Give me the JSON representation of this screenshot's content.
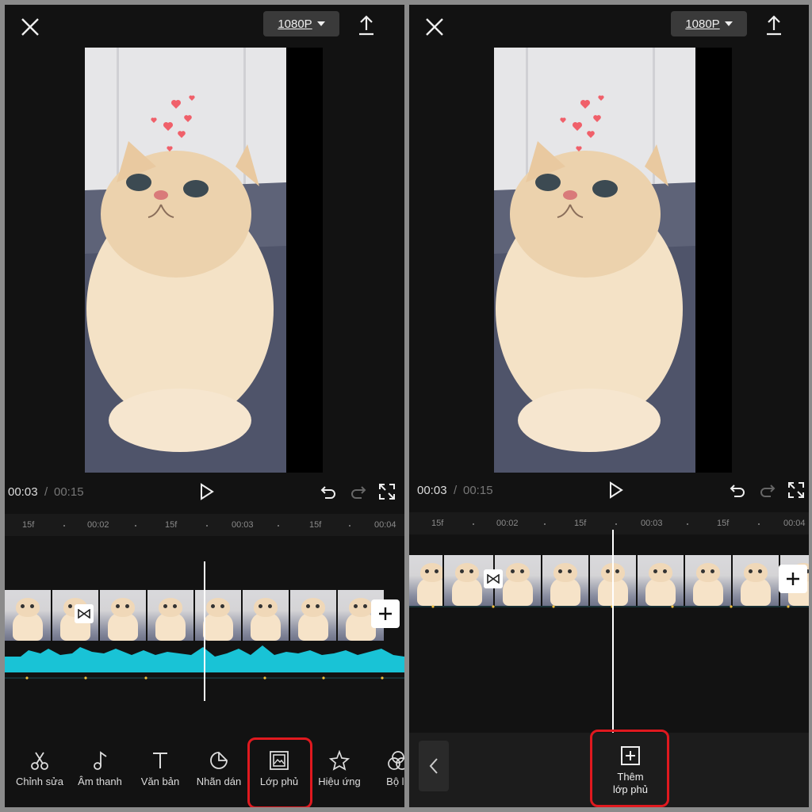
{
  "header": {
    "quality_label": "1080P"
  },
  "playback": {
    "current_time": "00:03",
    "separator": "/",
    "total_time": "00:15"
  },
  "ruler": {
    "left_labels": [
      "15f",
      "00:02",
      "15f",
      "00:03",
      "15f",
      "00:04"
    ],
    "right_labels": [
      "15f",
      "00:02",
      "15f",
      "00:03",
      "15f",
      "00:04"
    ]
  },
  "toolbar": {
    "items": [
      {
        "label": "Chỉnh sửa",
        "icon": "scissors-icon"
      },
      {
        "label": "Âm thanh",
        "icon": "music-note-icon"
      },
      {
        "label": "Văn bản",
        "icon": "text-icon"
      },
      {
        "label": "Nhãn dán",
        "icon": "sticker-icon"
      },
      {
        "label": "Lớp phủ",
        "icon": "overlay-icon"
      },
      {
        "label": "Hiệu ứng",
        "icon": "effects-star-icon"
      },
      {
        "label": "Bộ lọ",
        "icon": "filter-icon"
      }
    ]
  },
  "overlay_panel": {
    "add_label_line1": "Thêm",
    "add_label_line2": "lớp phủ"
  },
  "colors": {
    "background": "#121212",
    "highlight": "#e0191f",
    "audio_wave": "#19c3d6",
    "keyframe_dot": "#f0c040"
  }
}
